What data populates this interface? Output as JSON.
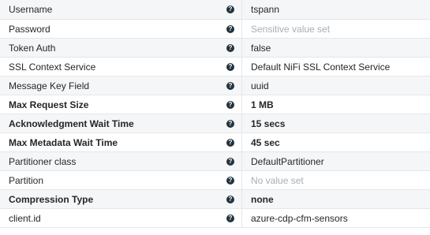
{
  "properties": [
    {
      "name": "Username",
      "value": "tspann",
      "required": false,
      "placeholder": false
    },
    {
      "name": "Password",
      "value": "Sensitive value set",
      "required": false,
      "placeholder": true
    },
    {
      "name": "Token Auth",
      "value": "false",
      "required": false,
      "placeholder": false
    },
    {
      "name": "SSL Context Service",
      "value": "Default NiFi SSL Context Service",
      "required": false,
      "placeholder": false
    },
    {
      "name": "Message Key Field",
      "value": "uuid",
      "required": false,
      "placeholder": false
    },
    {
      "name": "Max Request Size",
      "value": "1 MB",
      "required": true,
      "placeholder": false
    },
    {
      "name": "Acknowledgment Wait Time",
      "value": "15 secs",
      "required": true,
      "placeholder": false
    },
    {
      "name": "Max Metadata Wait Time",
      "value": "45 sec",
      "required": true,
      "placeholder": false
    },
    {
      "name": "Partitioner class",
      "value": "DefaultPartitioner",
      "required": false,
      "placeholder": false
    },
    {
      "name": "Partition",
      "value": "No value set",
      "required": false,
      "placeholder": true
    },
    {
      "name": "Compression Type",
      "value": "none",
      "required": true,
      "placeholder": false
    },
    {
      "name": "client.id",
      "value": "azure-cdp-cfm-sensors",
      "required": false,
      "placeholder": false
    }
  ],
  "help_glyph": "?",
  "icons": {
    "help": "question-circle-icon"
  }
}
